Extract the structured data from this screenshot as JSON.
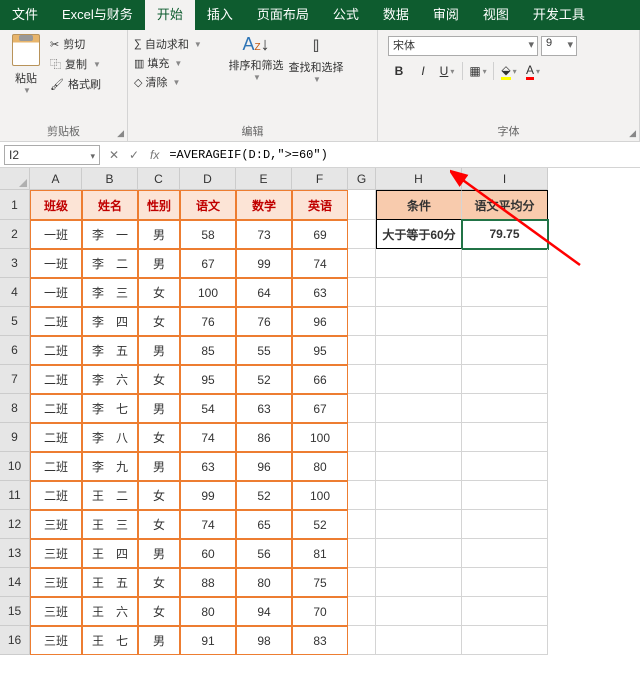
{
  "tabs": [
    "文件",
    "Excel与财务",
    "开始",
    "插入",
    "页面布局",
    "公式",
    "数据",
    "审阅",
    "视图",
    "开发工具"
  ],
  "activeTab": 2,
  "clipboard": {
    "group": "剪贴板",
    "paste": "粘贴",
    "cut": "剪切",
    "copy": "复制",
    "fmtPainter": "格式刷"
  },
  "editing": {
    "group": "编辑",
    "autosum": "自动求和",
    "fill": "填充",
    "clear": "清除",
    "sortFilter": "排序和筛选",
    "findSelect": "查找和选择"
  },
  "font": {
    "group": "字体",
    "name": "宋体",
    "size": "9"
  },
  "nameBox": "I2",
  "formula": "=AVERAGEIF(D:D,\">=60\")",
  "cols": [
    "A",
    "B",
    "C",
    "D",
    "E",
    "F",
    "G",
    "H",
    "I"
  ],
  "headers": {
    "class": "班级",
    "name": "姓名",
    "gender": "性别",
    "chinese": "语文",
    "math": "数学",
    "english": "英语",
    "cond": "条件",
    "avg": "语文平均分"
  },
  "side": {
    "cond": "大于等于60分",
    "avg": "79.75"
  },
  "rows": [
    {
      "class": "一班",
      "name": "李　一",
      "gender": "男",
      "c": 58,
      "m": 73,
      "e": 69
    },
    {
      "class": "一班",
      "name": "李　二",
      "gender": "男",
      "c": 67,
      "m": 99,
      "e": 74
    },
    {
      "class": "一班",
      "name": "李　三",
      "gender": "女",
      "c": 100,
      "m": 64,
      "e": 63
    },
    {
      "class": "二班",
      "name": "李　四",
      "gender": "女",
      "c": 76,
      "m": 76,
      "e": 96
    },
    {
      "class": "二班",
      "name": "李　五",
      "gender": "男",
      "c": 85,
      "m": 55,
      "e": 95
    },
    {
      "class": "二班",
      "name": "李　六",
      "gender": "女",
      "c": 95,
      "m": 52,
      "e": 66
    },
    {
      "class": "二班",
      "name": "李　七",
      "gender": "男",
      "c": 54,
      "m": 63,
      "e": 67
    },
    {
      "class": "二班",
      "name": "李　八",
      "gender": "女",
      "c": 74,
      "m": 86,
      "e": 100
    },
    {
      "class": "二班",
      "name": "李　九",
      "gender": "男",
      "c": 63,
      "m": 96,
      "e": 80
    },
    {
      "class": "二班",
      "name": "王　二",
      "gender": "女",
      "c": 99,
      "m": 52,
      "e": 100
    },
    {
      "class": "三班",
      "name": "王　三",
      "gender": "女",
      "c": 74,
      "m": 65,
      "e": 52
    },
    {
      "class": "三班",
      "name": "王　四",
      "gender": "男",
      "c": 60,
      "m": 56,
      "e": 81
    },
    {
      "class": "三班",
      "name": "王　五",
      "gender": "女",
      "c": 88,
      "m": 80,
      "e": 75
    },
    {
      "class": "三班",
      "name": "王　六",
      "gender": "女",
      "c": 80,
      "m": 94,
      "e": 70
    },
    {
      "class": "三班",
      "name": "王　七",
      "gender": "男",
      "c": 91,
      "m": 98,
      "e": 83
    }
  ]
}
